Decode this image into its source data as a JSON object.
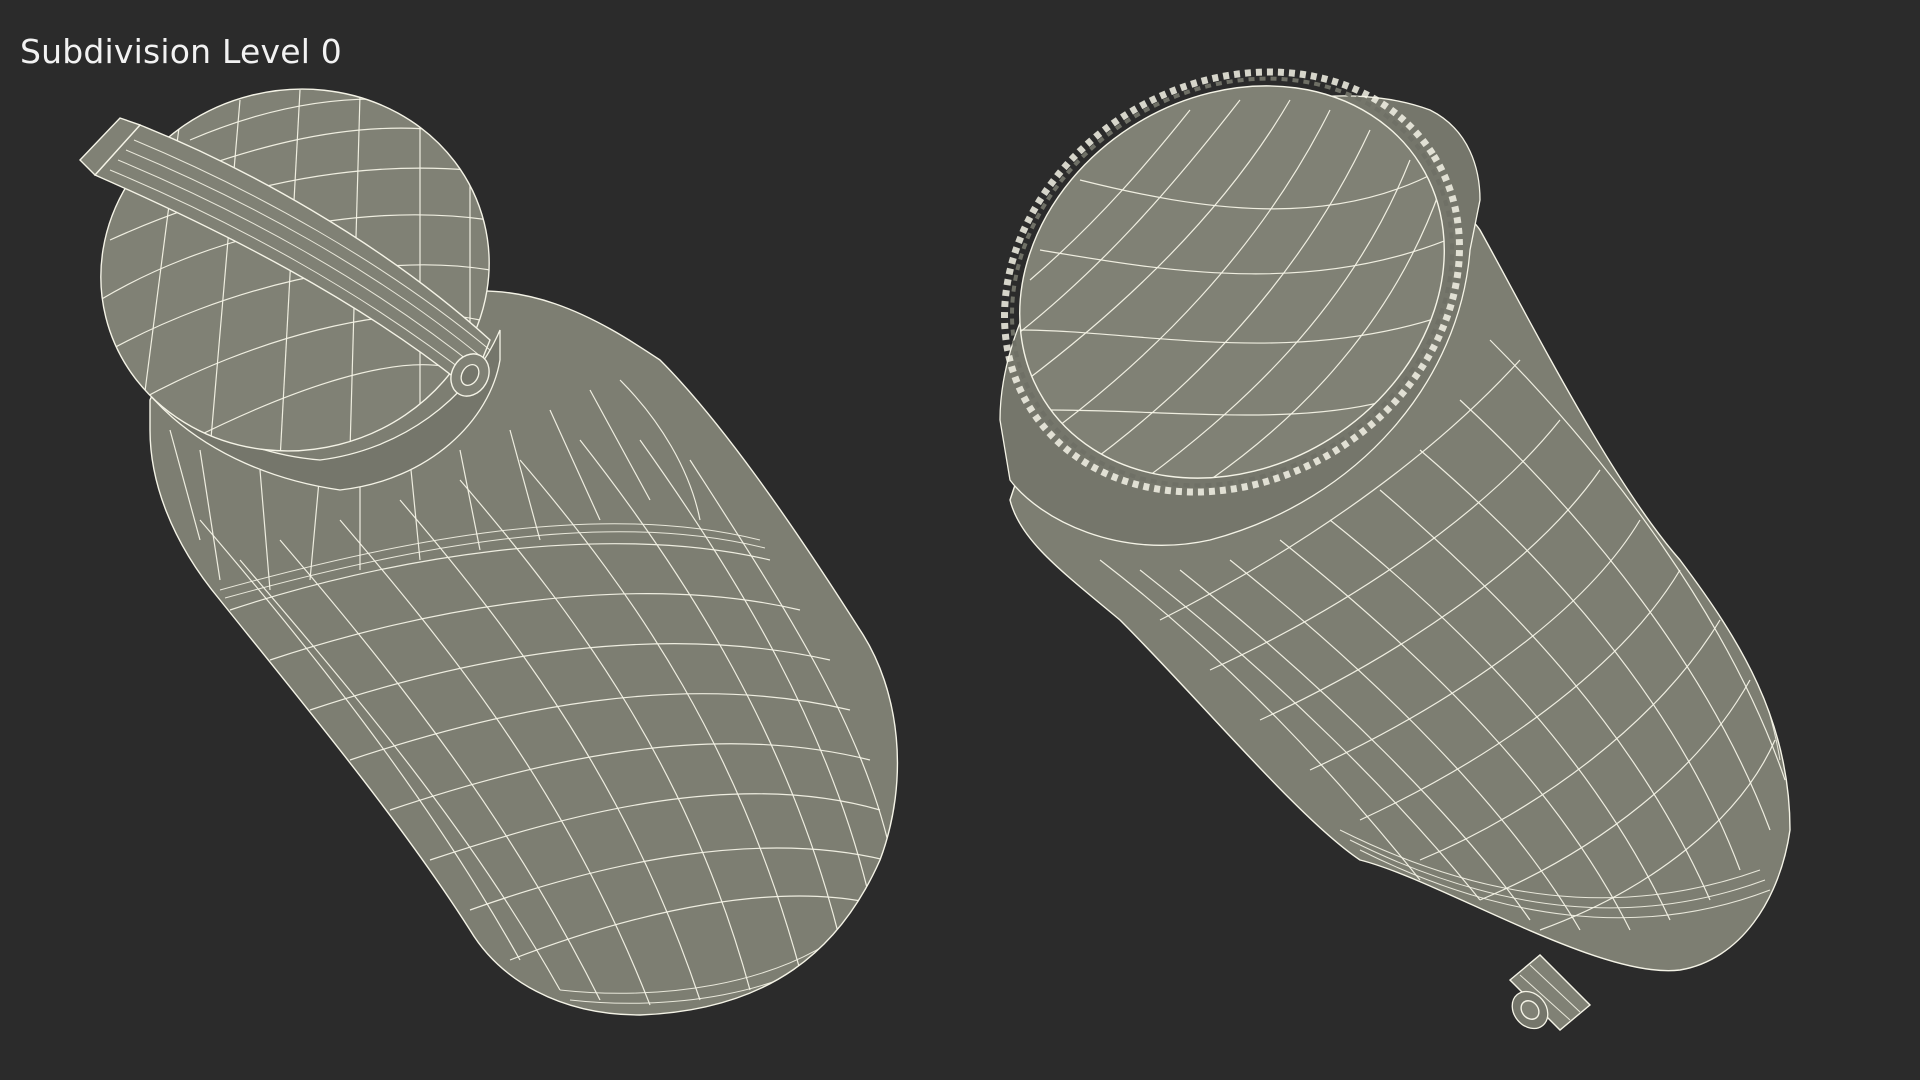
{
  "caption": "Subdivision Level 0",
  "scene": {
    "background_color": "#2b2b2b",
    "mesh_fill_color": "#7d7e72",
    "wire_color": "#f4f3e6",
    "models": [
      {
        "name": "spray-can-left",
        "view": "top-angled"
      },
      {
        "name": "spray-can-right",
        "view": "bottom-angled"
      }
    ]
  }
}
